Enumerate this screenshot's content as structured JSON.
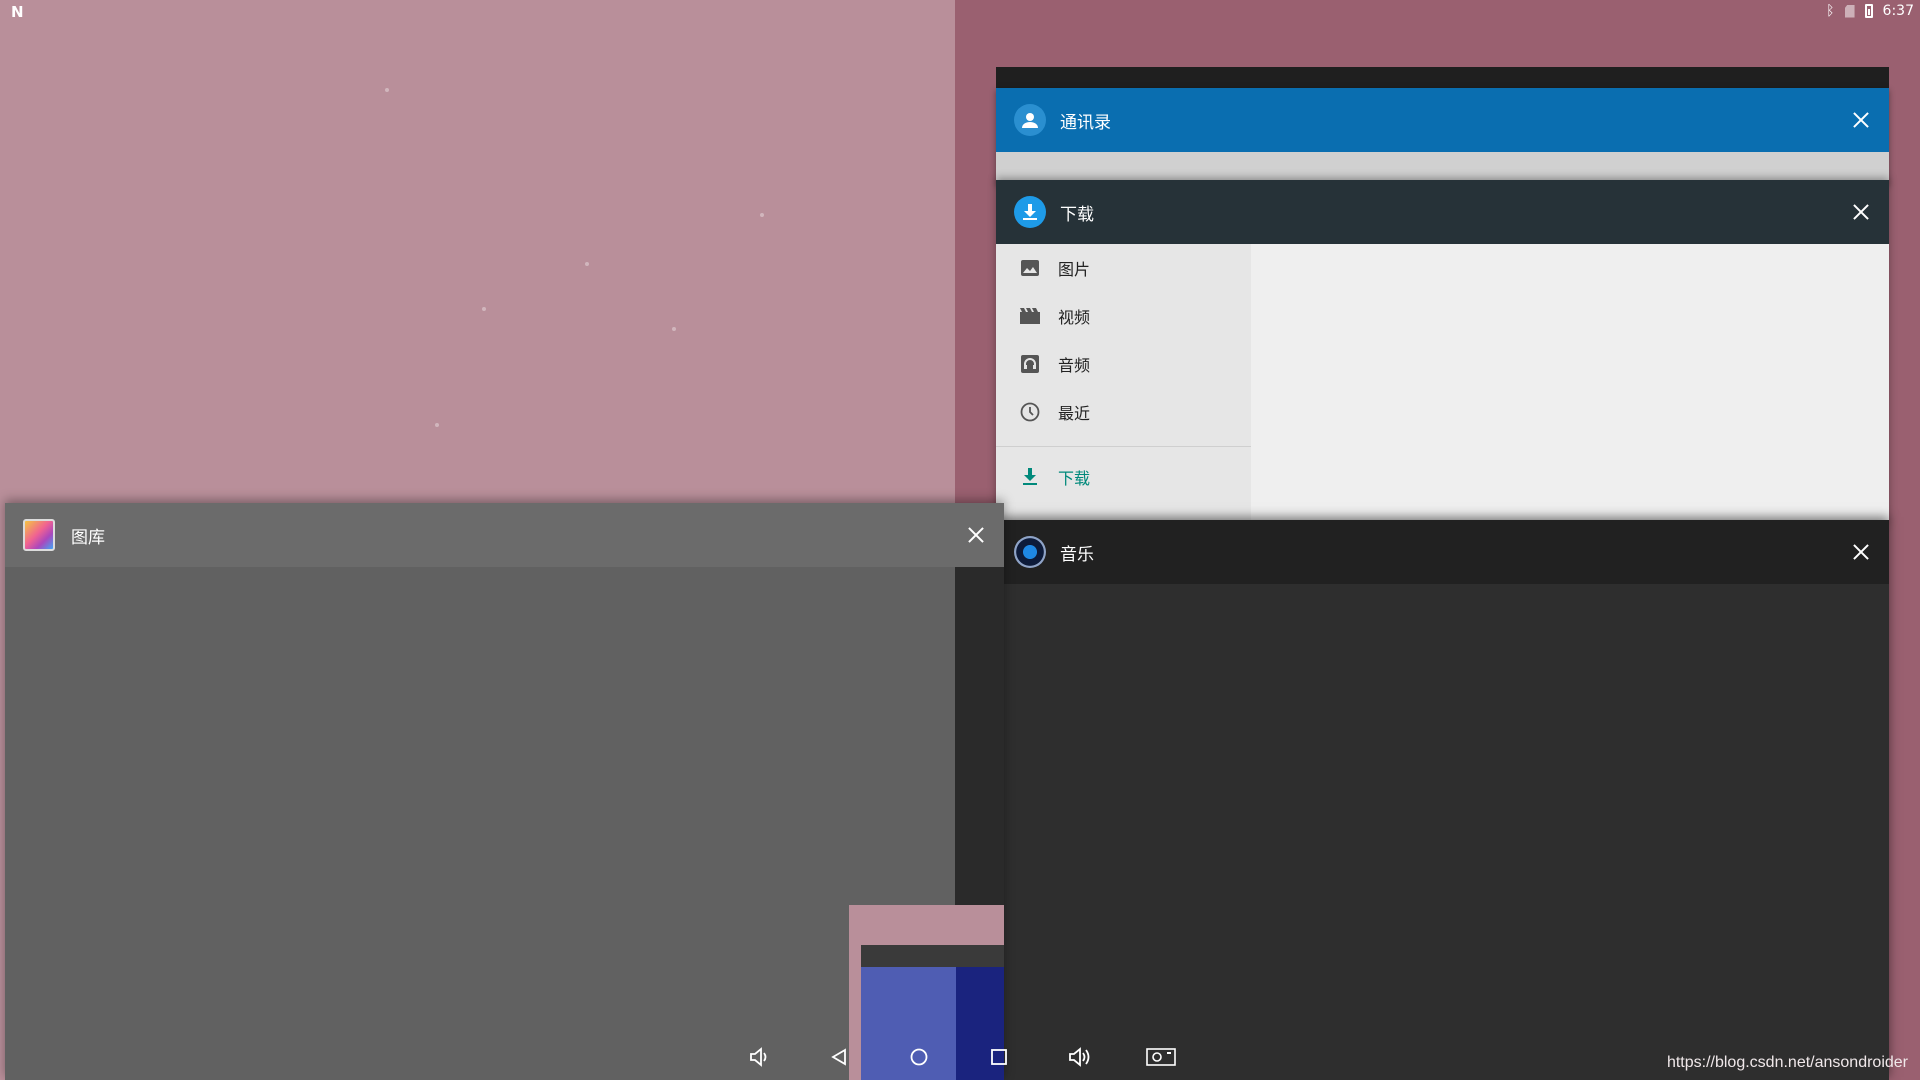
{
  "status_bar": {
    "time": "6:37"
  },
  "cards": {
    "contacts": {
      "title": "通讯录"
    },
    "downloads": {
      "title": "下载",
      "sidebar": [
        {
          "label": "图片",
          "icon": "image-icon"
        },
        {
          "label": "视频",
          "icon": "video-icon"
        },
        {
          "label": "音频",
          "icon": "audio-icon"
        },
        {
          "label": "最近",
          "icon": "clock-icon"
        }
      ],
      "active_item": {
        "label": "下载",
        "icon": "download-icon"
      }
    },
    "music": {
      "title": "音乐"
    },
    "gallery": {
      "title": "图库"
    }
  },
  "watermark": "https://blog.csdn.net/ansondroider",
  "colors": {
    "contacts_header": "#0a6eb0",
    "downloads_header": "#263238",
    "active_accent": "#00897b",
    "wallpaper": "#b98f9a"
  }
}
